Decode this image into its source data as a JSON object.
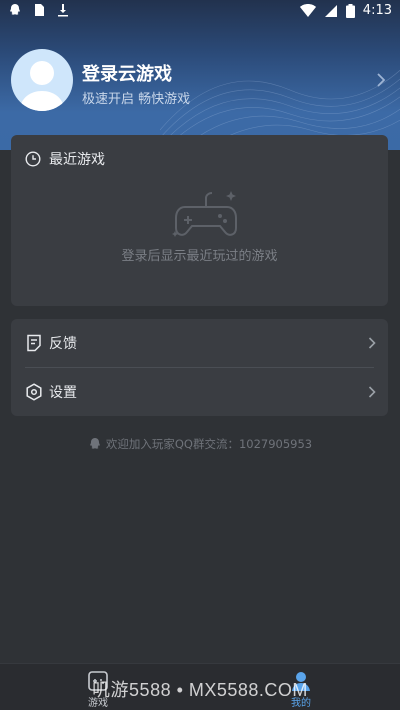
{
  "status_bar": {
    "time": "4:13"
  },
  "profile": {
    "title": "登录云游戏",
    "subtitle": "极速开启 畅快游戏"
  },
  "recent": {
    "header": "最近游戏",
    "empty_text": "登录后显示最近玩过的游戏"
  },
  "menu": {
    "items": [
      {
        "label": "反馈"
      },
      {
        "label": "设置"
      }
    ]
  },
  "qq_group": {
    "text": "欢迎加入玩家QQ群交流：1027905953"
  },
  "bottom_nav": {
    "games_label": "游戏",
    "mine_label": "我的"
  },
  "watermark": "叽游5588 • MX5588.COM",
  "colors": {
    "accent": "#5aa4ea",
    "card": "#3a3d42",
    "background": "#2f3236"
  }
}
